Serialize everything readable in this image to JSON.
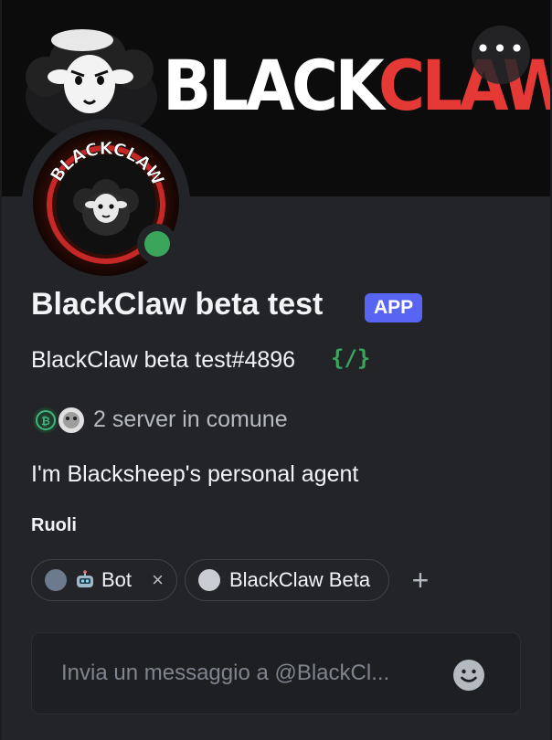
{
  "banner": {
    "text_white": "BLACK",
    "text_red": "CLAW",
    "menu_icon": "more-dots-icon"
  },
  "avatar": {
    "logo_text": "BLACKCLAW",
    "status": "online",
    "status_color": "#3ba55c"
  },
  "profile": {
    "display_name": "BlackClaw beta test",
    "badge": "APP",
    "username": "BlackClaw beta test#4896",
    "command_icon_text": "{/}",
    "mutual_servers": "2 server in comune",
    "bio": "I'm Blacksheep's personal agent"
  },
  "roles": {
    "heading": "Ruoli",
    "items": [
      {
        "label": "Bot",
        "color": "#6b7a8c",
        "icon": "robot-icon",
        "removable": true,
        "remove_icon": "×"
      },
      {
        "label": "BlackClaw Beta",
        "color": "#c9cdd3",
        "removable": false
      }
    ],
    "add_label": "+"
  },
  "composer": {
    "placeholder": "Invia un messaggio a @BlackCl...",
    "emoji_icon": "smiley-icon"
  },
  "colors": {
    "brand_red": "#e53935",
    "app_badge": "#5865f2",
    "card_bg": "#232428"
  }
}
